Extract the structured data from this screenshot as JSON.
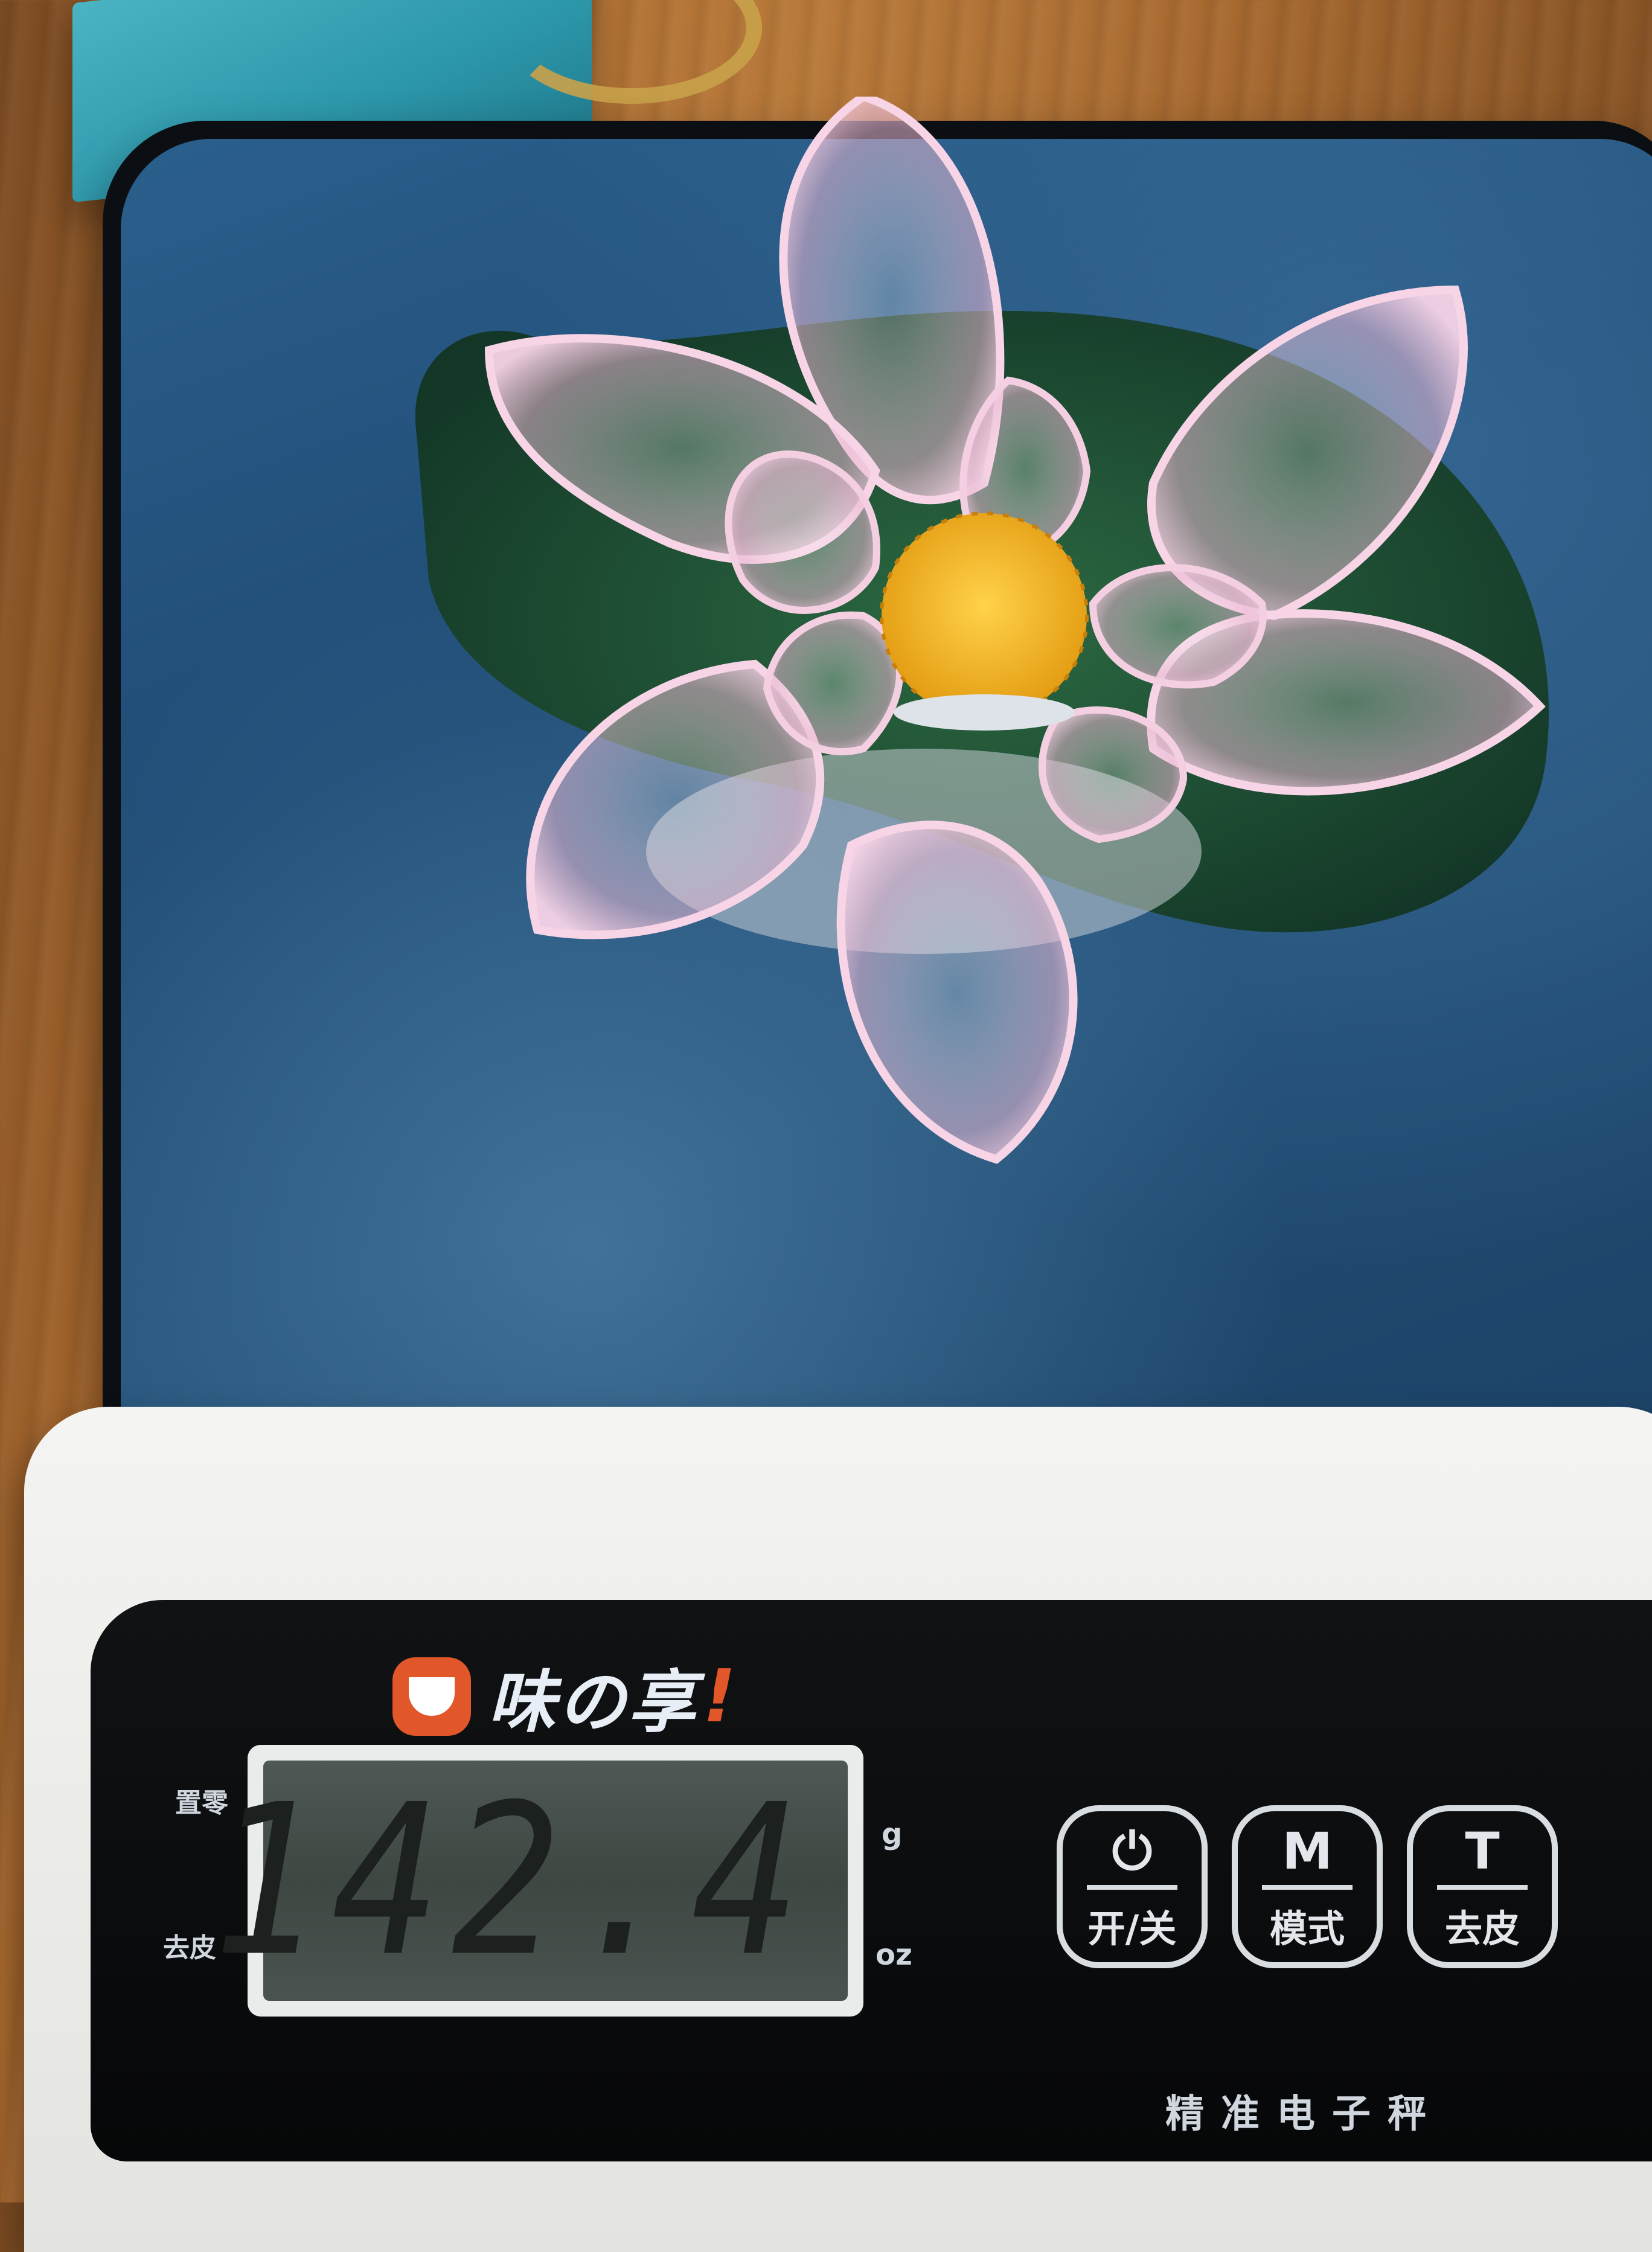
{
  "scale": {
    "brand_name": "味の享",
    "brand_mark": "!",
    "reading": "142.4",
    "unit_top": "g",
    "unit_bottom": "oz",
    "left_label_top": "置零",
    "left_label_bottom": "去皮",
    "buttons": [
      {
        "symbol": "⏻",
        "label": "开/关",
        "icon": "power-icon"
      },
      {
        "symbol": "M",
        "label": "模式",
        "icon": "mode-letter"
      },
      {
        "symbol": "T",
        "label": "去皮",
        "icon": "tare-letter"
      }
    ],
    "caption": "精准电子秤"
  },
  "colors": {
    "platform_blue": "#234f76",
    "panel_black": "#0b0d0f",
    "brand_orange": "#e2572a",
    "petal_pink": "#f1c6dc",
    "stamen_yellow": "#f2b51d",
    "leaf_green": "#1d4a2d"
  }
}
